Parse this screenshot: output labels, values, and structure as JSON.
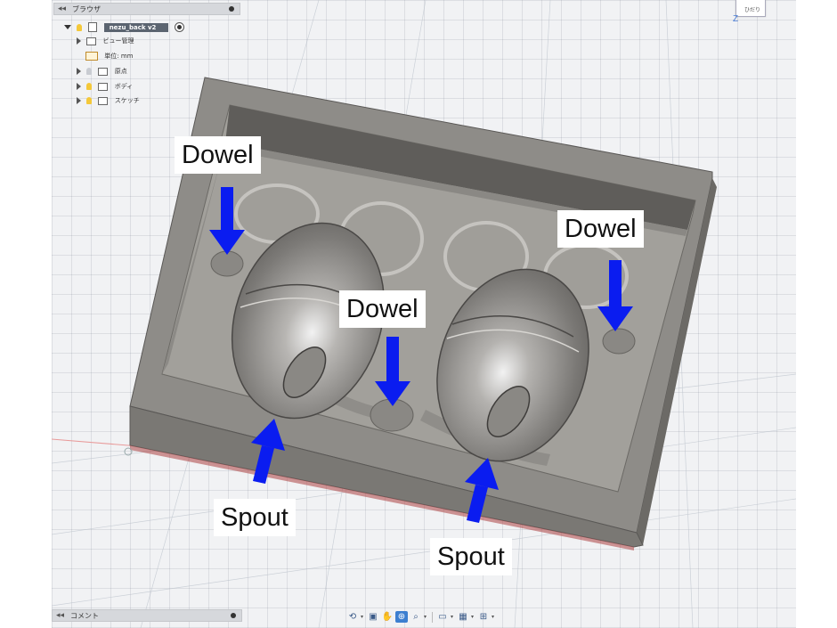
{
  "browser": {
    "title": "ブラウザ",
    "root_label": "nezu_back v2",
    "items": [
      {
        "label": "ビュー管理"
      },
      {
        "label": "単位: mm"
      },
      {
        "label": "原点"
      },
      {
        "label": "ボディ"
      },
      {
        "label": "スケッチ"
      }
    ]
  },
  "viewcube": {
    "face_label": "ひだり",
    "axis_label": "Z"
  },
  "comment_panel": {
    "title": "コメント"
  },
  "nav_toolbar": {
    "icons": [
      "orbit-icon",
      "look-at-icon",
      "pan-icon",
      "zoom-icon",
      "fit-icon",
      "display-settings-icon",
      "grid-icon",
      "viewports-icon"
    ]
  },
  "annotations": [
    {
      "text": "Dowel"
    },
    {
      "text": "Dowel"
    },
    {
      "text": "Dowel"
    },
    {
      "text": "Spout"
    },
    {
      "text": "Spout"
    }
  ],
  "colors": {
    "mold_top": "#8e8c88",
    "mold_front": "#7a7874",
    "mold_floor": "#a2a09b",
    "arrow": "#0a1cf0",
    "grid_bg": "#f1f2f4",
    "browser_header": "#d6d8dc"
  }
}
